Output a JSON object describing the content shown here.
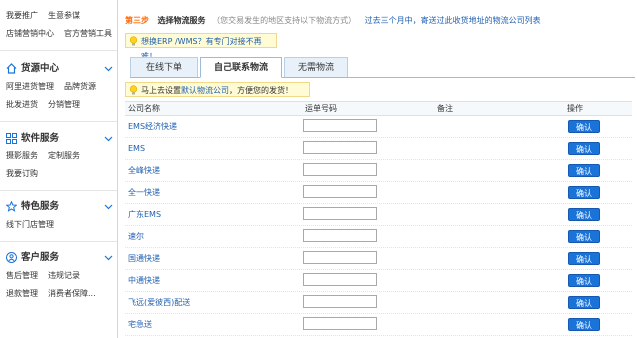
{
  "sidebar": {
    "top_rows": [
      [
        "我要推广",
        "生意参谋"
      ],
      [
        "店铺营销中心",
        "官方营销工具"
      ]
    ],
    "sections": [
      {
        "title": "货源中心",
        "icon": "house-icon",
        "rows": [
          [
            "阿里进货管理",
            "品牌货源"
          ],
          [
            "批发进货",
            "分销管理"
          ]
        ]
      },
      {
        "title": "软件服务",
        "icon": "grid-icon",
        "rows": [
          [
            "摄影服务",
            "定制服务"
          ],
          [
            "我要订购"
          ]
        ]
      },
      {
        "title": "特色服务",
        "icon": "star-icon",
        "rows": [
          [
            "线下门店管理"
          ]
        ]
      },
      {
        "title": "客户服务",
        "icon": "person-icon",
        "rows": [
          [
            "售后管理",
            "违规记录"
          ],
          [
            "退款管理",
            "消费者保障..."
          ]
        ]
      }
    ]
  },
  "main": {
    "step_label": "第三步",
    "step_title": "选择物流服务",
    "step_note": "（您交易发生的地区支持以下物流方式）",
    "step_link": "过去三个月中，寄送过此收货地址的物流公司列表",
    "tip_erp": "想换ERP /WMS？有专门对接不再难！",
    "tabs": [
      "在线下单",
      "自己联系物流",
      "无需物流"
    ],
    "active_tab": 1,
    "tip_default_prefix": "马上去设置",
    "tip_default_link": "默认物流公司",
    "tip_default_suffix": "，方便您的发货！",
    "table": {
      "headers": [
        "公司名称",
        "运单号码",
        "备注",
        "操作"
      ],
      "confirm_label": "确认",
      "rows": [
        "EMS经济快递",
        "EMS",
        "全峰快递",
        "全一快递",
        "广东EMS",
        "速尔",
        "国通快递",
        "中通快递",
        "飞远(爱彼西)配送",
        "宅急送"
      ]
    }
  },
  "colors": {
    "accent": "#1a73d9",
    "step": "#ff6600",
    "link": "#1f5fb0",
    "tip_bg": "#fffbd5"
  }
}
